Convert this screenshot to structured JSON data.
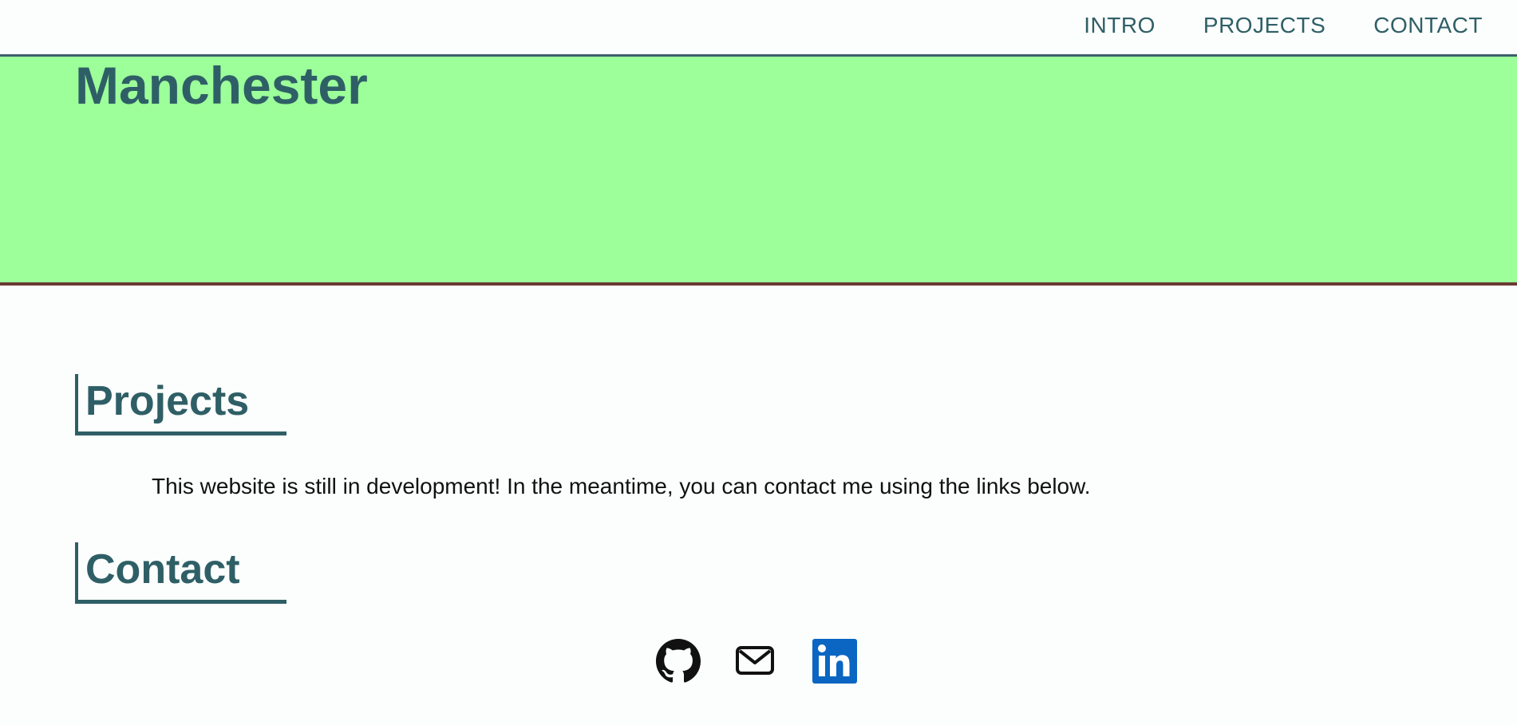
{
  "nav": {
    "items": [
      {
        "label": "INTRO"
      },
      {
        "label": "PROJECTS"
      },
      {
        "label": "CONTACT"
      }
    ]
  },
  "hero": {
    "title": "Manchester"
  },
  "projects": {
    "heading": "Projects",
    "text": "This website is still in development! In the meantime, you can contact me using the links below."
  },
  "contact": {
    "heading": "Contact",
    "links": [
      {
        "icon": "github-icon"
      },
      {
        "icon": "mail-icon"
      },
      {
        "icon": "linkedin-icon"
      }
    ]
  },
  "colors": {
    "accent": "#2f5f66",
    "hero_bg": "#9cff9a",
    "hero_border": "#6b3b34",
    "linkedin": "#0a66c2",
    "page_bg": "#fbfefc"
  }
}
